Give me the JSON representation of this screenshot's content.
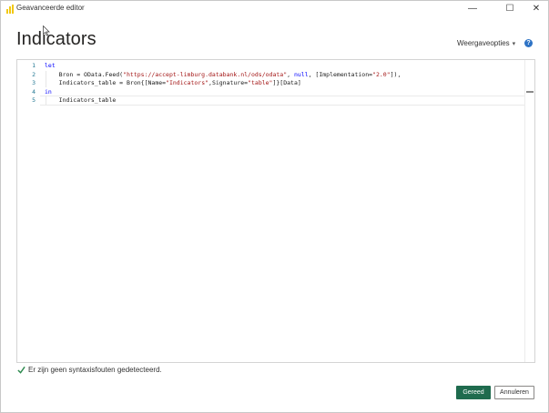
{
  "window": {
    "title": "Geavanceerde editor",
    "minimize_symbol": "—",
    "maximize_symbol": "☐",
    "close_symbol": "✕"
  },
  "header": {
    "title": "Indicators",
    "view_options_label": "Weergaveopties",
    "help_symbol": "?"
  },
  "editor": {
    "line_numbers": [
      "1",
      "2",
      "3",
      "4",
      "5"
    ],
    "lines": [
      [
        {
          "t": "let",
          "c": "kw"
        }
      ],
      [
        {
          "t": "    Bron = OData.Feed(",
          "c": ""
        },
        {
          "t": "\"https://accept-limburg.databank.nl/ods/odata\"",
          "c": "str"
        },
        {
          "t": ", ",
          "c": ""
        },
        {
          "t": "null",
          "c": "nul"
        },
        {
          "t": ", [Implementation=",
          "c": ""
        },
        {
          "t": "\"2.0\"",
          "c": "str"
        },
        {
          "t": "]),",
          "c": ""
        }
      ],
      [
        {
          "t": "    Indicators_table = Bron{[Name=",
          "c": ""
        },
        {
          "t": "\"Indicators\"",
          "c": "str"
        },
        {
          "t": ",Signature=",
          "c": ""
        },
        {
          "t": "\"table\"",
          "c": "str"
        },
        {
          "t": "]}[Data]",
          "c": ""
        }
      ],
      [
        {
          "t": "in",
          "c": "kw"
        }
      ],
      [
        {
          "t": "    Indicators_table",
          "c": ""
        }
      ]
    ]
  },
  "status": {
    "message": "Er zijn geen syntaxisfouten gedetecteerd."
  },
  "buttons": {
    "done_label": "Gereed",
    "cancel_label": "Annuleren"
  },
  "colors": {
    "accent": "#1f6b4e",
    "keyword": "#0000ff",
    "string": "#a31515",
    "check": "#2d8a4e",
    "help": "#2e73c5"
  },
  "icons": {
    "app": "power-bi-icon",
    "status": "checkmark-icon",
    "help": "help-icon",
    "dropdown": "chevron-down-icon"
  }
}
